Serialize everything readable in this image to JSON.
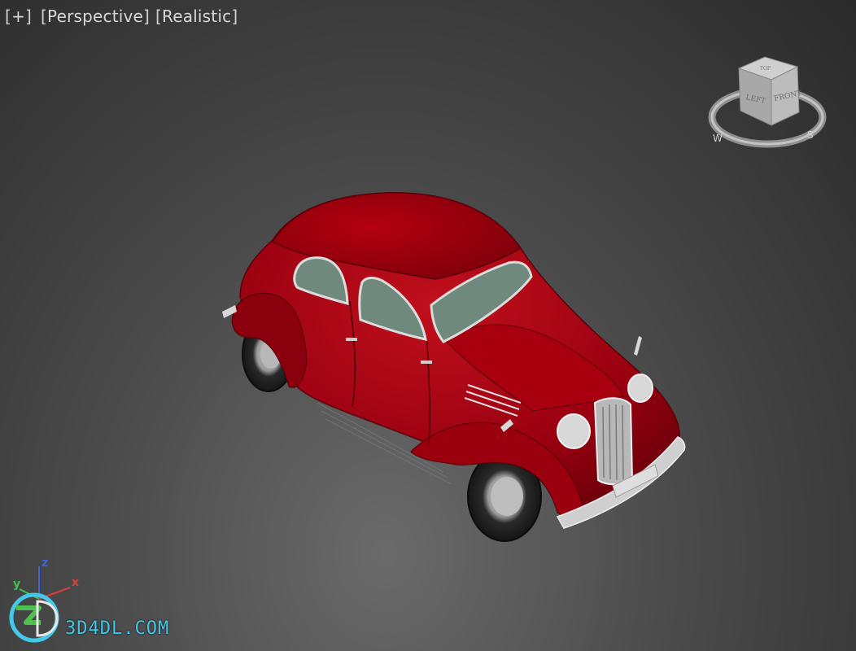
{
  "viewport": {
    "labels": {
      "plus": "+",
      "view": "Perspective",
      "shading": "Realistic"
    },
    "viewcube": {
      "face_left": "LEFT",
      "face_right": "FRONT",
      "face_top": "TOP",
      "compass_w": "W",
      "compass_s": "S"
    },
    "axis_triad": {
      "z": "z",
      "y": "y",
      "x": "x"
    },
    "watermark": {
      "text": "3D4DL.COM"
    },
    "colors": {
      "car_body": "#a3000c",
      "glass": "#6f8a7c",
      "axis_x": "#d9413a",
      "axis_y": "#43c24a",
      "axis_z": "#3a64d8",
      "watermark": "#43c8e8"
    }
  }
}
